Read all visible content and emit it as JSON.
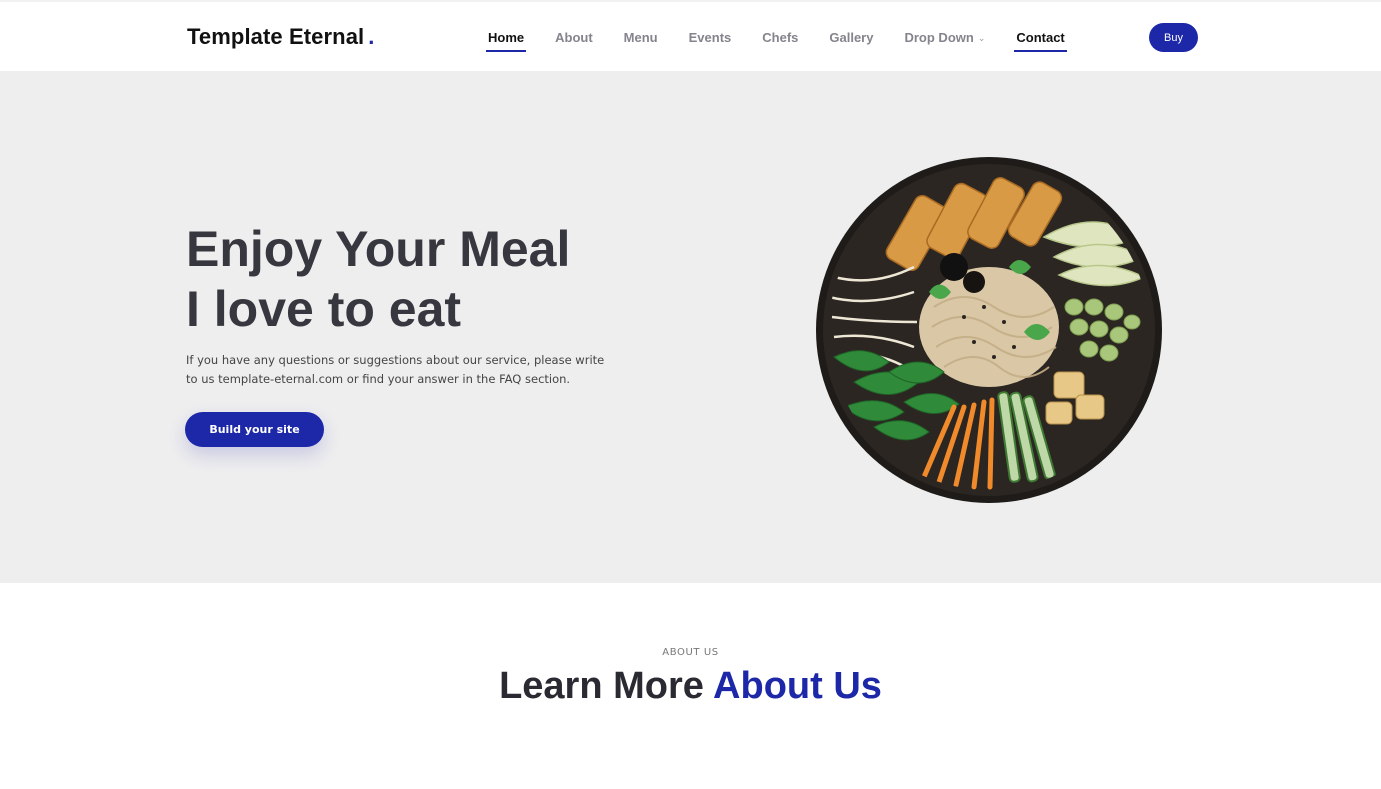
{
  "header": {
    "logo": "Template Eternal",
    "logo_dot": ".",
    "nav": [
      {
        "label": "Home",
        "active": true
      },
      {
        "label": "About",
        "active": false
      },
      {
        "label": "Menu",
        "active": false
      },
      {
        "label": "Events",
        "active": false
      },
      {
        "label": "Chefs",
        "active": false
      },
      {
        "label": "Gallery",
        "active": false
      },
      {
        "label": "Drop Down",
        "active": false
      },
      {
        "label": "Contact",
        "active": true
      }
    ],
    "buy_label": "Buy"
  },
  "hero": {
    "title_line1": "Enjoy Your Meal",
    "title_line2": "I love to eat",
    "description": "If you have any questions or suggestions about our service, please write to us template-eternal.com or find your answer in the FAQ section.",
    "cta_label": "Build your site"
  },
  "about": {
    "eyebrow": "ABOUT US",
    "title_plain": "Learn More",
    "title_accent": "About Us"
  },
  "colors": {
    "accent": "#1d28a8",
    "hero_bg": "#eeeeef",
    "heading": "#37373f"
  },
  "icons": {
    "dropdown": "chevron-down-icon"
  }
}
